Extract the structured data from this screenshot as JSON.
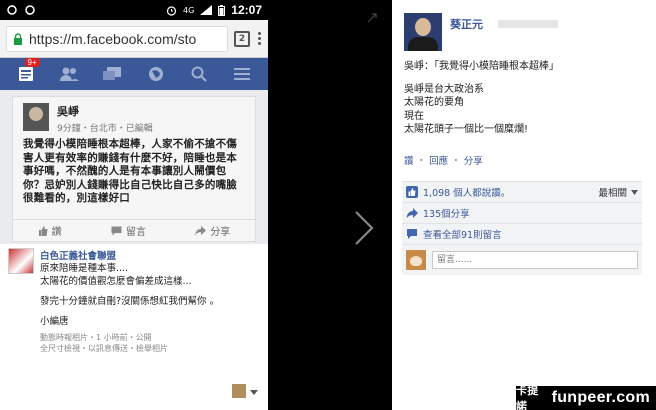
{
  "status_bar": {
    "time": "12:07",
    "network": "4G"
  },
  "browser": {
    "url": "https://m.facebook.com/sto",
    "tab_count": "2"
  },
  "fb_nav": {
    "notification_badge": "9+"
  },
  "phone_post": {
    "author": "吳崢",
    "meta": "9分鐘・台北市・已編輯",
    "text": "我覺得小模陪睡根本超棒，人家不偷不搶不傷害人更有效率的賺錢有什麼不好，陪睡也是本事好嗎，不然醜的人是有本事讓別人鬧價包你？忌妒別人錢賺得比自己快比自己多的嘴臉很難看的，別這樣好口",
    "actions": {
      "like": "讚",
      "comment": "留言",
      "share": "分享"
    }
  },
  "phone_comment": {
    "author": "白色正義社會聯盟",
    "lines": [
      "原來陪睡是種本事....",
      "太陽花的價值觀怎麼會偏差成這樣...",
      "",
      "發完十分鐘就自刪?沒關係想紅我們幫你 。",
      "",
      "小編唐"
    ],
    "footer": "動態時報相片・1 小時前・公開",
    "footer2": "全尺寸檢視・以訊息傳送・檢舉相片"
  },
  "panel": {
    "author": "葵正元",
    "lines": [
      "吳崢：「我覺得小模陪睡根本超棒」",
      "",
      "吳崢是台大政治系",
      "太陽花的要角",
      "現在",
      "太陽花頭子一個比一個糜爛!"
    ],
    "links": [
      "讚",
      "回應",
      "分享"
    ],
    "likes": "1,098 個人都說讚。",
    "sort": "最相關",
    "shares": "135個分享",
    "view_comments": "查看全部91則留言",
    "comment_placeholder": "留言......"
  },
  "watermark": {
    "site": "funpeer.com",
    "label": "卡提諾"
  }
}
